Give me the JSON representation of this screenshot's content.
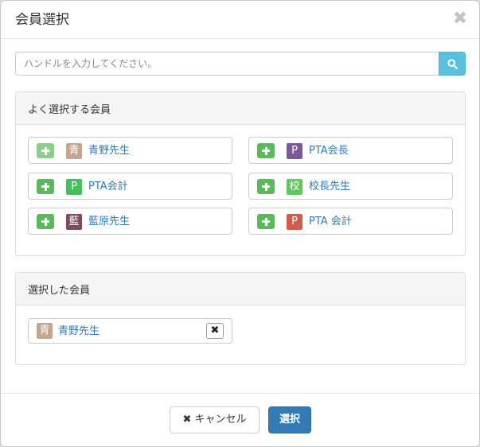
{
  "modal": {
    "title": "会員選択",
    "close_glyph": "✖"
  },
  "search": {
    "placeholder": "ハンドルを入力してください。",
    "value": "",
    "icon": "search-icon"
  },
  "frequent": {
    "heading": "よく選択する会員",
    "members": [
      {
        "avatar_char": "青",
        "avatar_color": "#c7a58c",
        "name": "青野先生",
        "added": true
      },
      {
        "avatar_char": "P",
        "avatar_color": "#7a5a96",
        "name": "PTA会長",
        "added": false
      },
      {
        "avatar_char": "P",
        "avatar_color": "#43c059",
        "name": "PTA会計",
        "added": false
      },
      {
        "avatar_char": "校",
        "avatar_color": "#5ec85e",
        "name": "校長先生",
        "added": false
      },
      {
        "avatar_char": "藍",
        "avatar_color": "#7d4a5e",
        "name": "藍原先生",
        "added": false
      },
      {
        "avatar_char": "P",
        "avatar_color": "#d25a4e",
        "name": "PTA 会計",
        "added": false
      }
    ]
  },
  "selected": {
    "heading": "選択した会員",
    "members": [
      {
        "avatar_char": "青",
        "avatar_color": "#c7a58c",
        "name": "青野先生",
        "remove_glyph": "✖"
      }
    ]
  },
  "footer": {
    "cancel_glyph": "✖",
    "cancel_label": "キャンセル",
    "select_label": "選択"
  },
  "colors": {
    "primary": "#337ab7",
    "success": "#5cb85c",
    "info": "#5bc0de"
  }
}
